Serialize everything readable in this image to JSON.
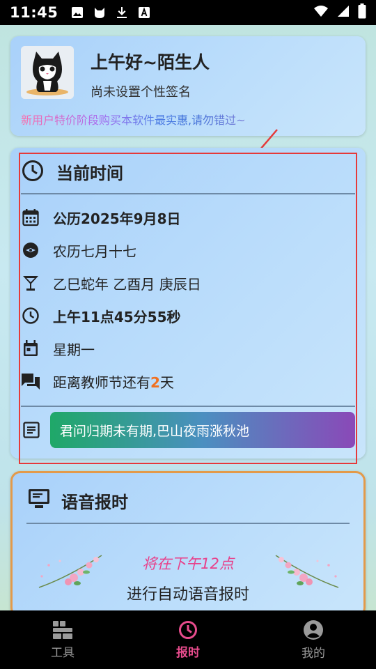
{
  "status_bar": {
    "time": "11:45",
    "notification_icons": [
      "image-icon",
      "cat-icon",
      "download-icon",
      "text-a-icon"
    ],
    "right_icons": [
      "wifi-icon",
      "signal-icon",
      "battery-icon"
    ]
  },
  "profile": {
    "greeting": "上午好~陌生人",
    "signature": "尚未设置个性签名",
    "promo": "新用户特价阶段购买本软件最实惠,请勿错过~"
  },
  "time_card": {
    "title": "当前时间",
    "rows": [
      {
        "icon": "calendar-icon",
        "text": "公历2025年9月8日"
      },
      {
        "icon": "compass-icon",
        "text": "农历七月十七"
      },
      {
        "icon": "cocktail-icon",
        "text": "乙巳蛇年 乙酉月 庚辰日"
      },
      {
        "icon": "clock-icon",
        "text": "上午11点45分55秒"
      },
      {
        "icon": "event-icon",
        "text": "星期一"
      }
    ],
    "countdown": {
      "prefix": "距离教师节还有",
      "days": "2",
      "suffix": "天",
      "days_color": "#f07020"
    },
    "poem": "君问归期未有期,巴山夜雨涨秋池"
  },
  "voice_card": {
    "title": "语音报时",
    "next": "将在下午12点",
    "desc": "进行自动语音报时"
  },
  "nav": {
    "tools": "工具",
    "announce": "报时",
    "mine": "我的",
    "active_color": "#e84c8d"
  }
}
